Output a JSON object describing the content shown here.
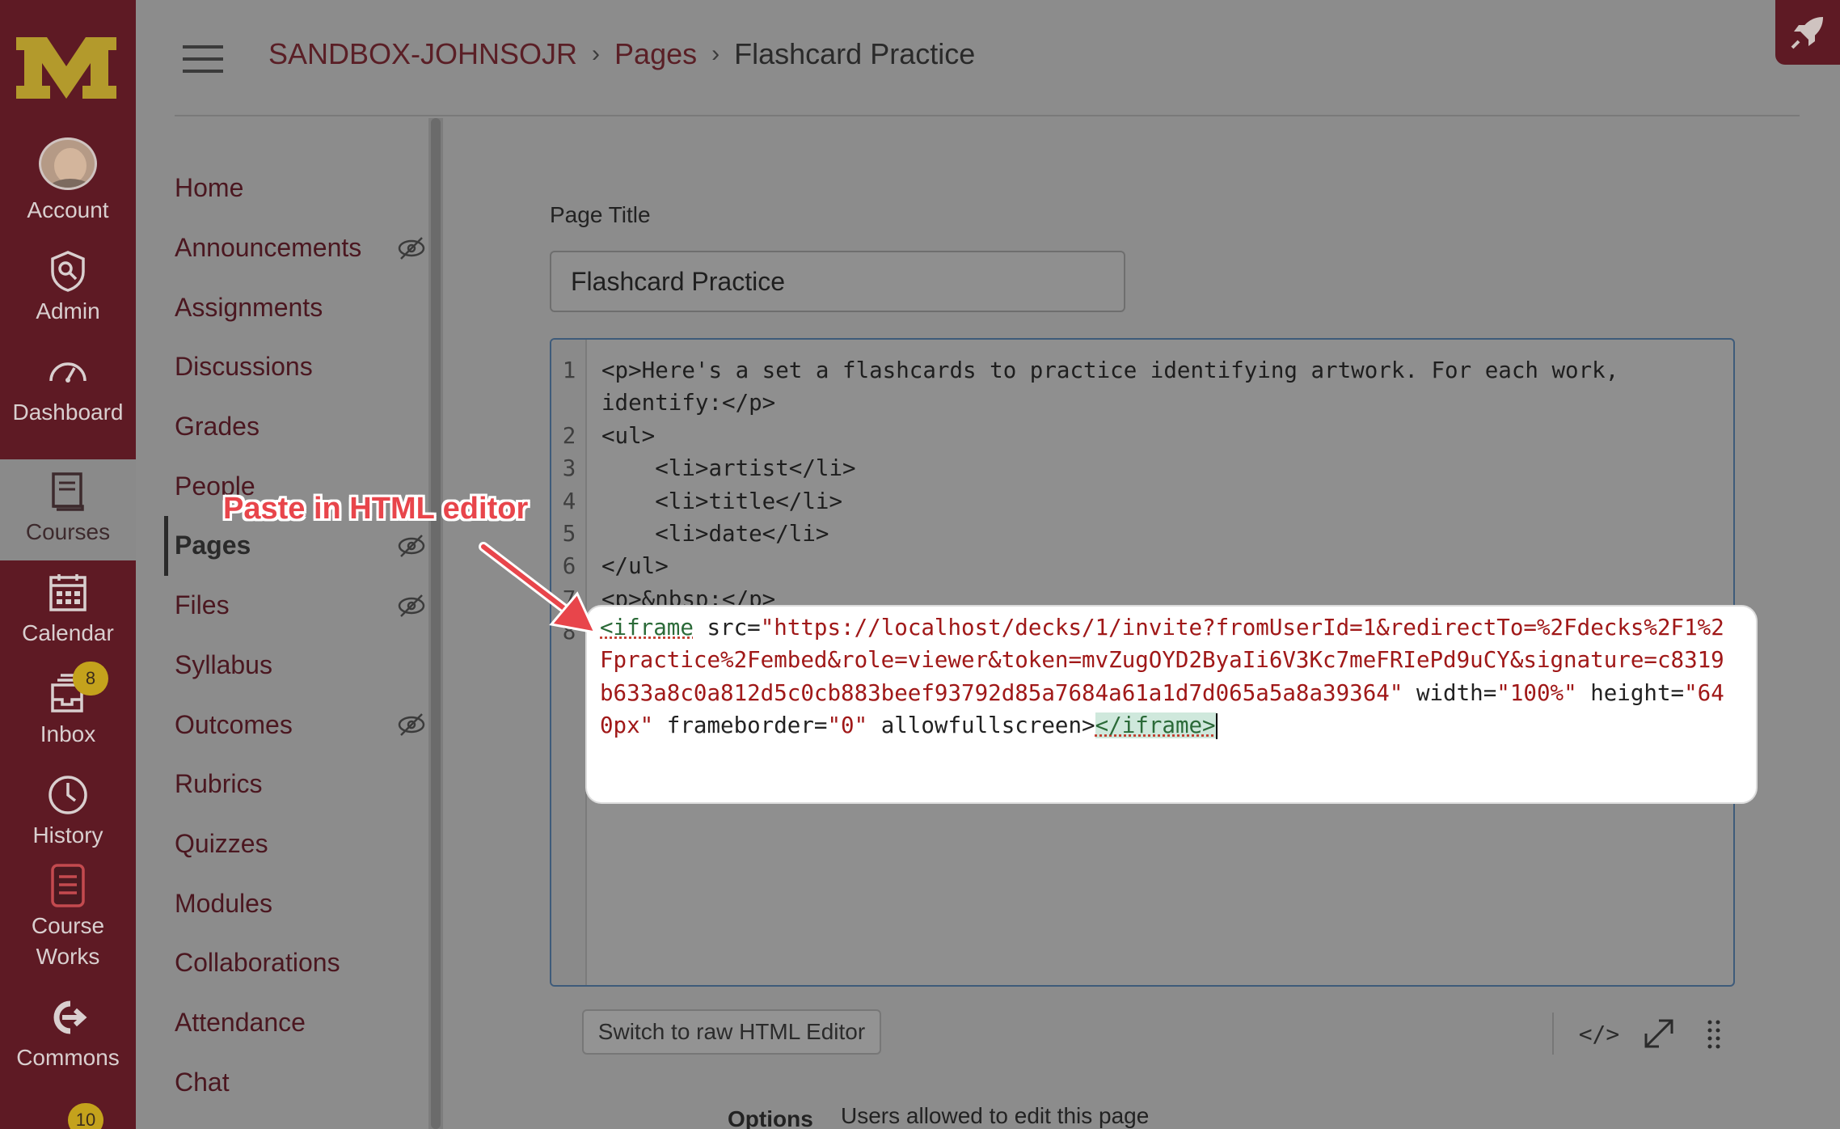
{
  "global_nav": {
    "items": [
      {
        "label": "Account",
        "icon": "avatar"
      },
      {
        "label": "Admin",
        "icon": "admin-icon"
      },
      {
        "label": "Dashboard",
        "icon": "dashboard-icon"
      },
      {
        "label": "Courses",
        "icon": "courses-icon"
      },
      {
        "label": "Calendar",
        "icon": "calendar-icon"
      },
      {
        "label": "Inbox",
        "icon": "inbox-icon",
        "badge": "8"
      },
      {
        "label": "History",
        "icon": "clock-icon"
      },
      {
        "label": "Course\nWorks",
        "icon": "courseworks-icon"
      },
      {
        "label": "Commons",
        "icon": "commons-icon"
      }
    ],
    "bottom_badge": "10"
  },
  "header": {
    "breadcrumbs": [
      "SANDBOX-JOHNSOJR",
      "Pages",
      "Flashcard Practice"
    ]
  },
  "course_nav": {
    "items": [
      {
        "label": "Home",
        "hidden": false
      },
      {
        "label": "Announcements",
        "hidden": true
      },
      {
        "label": "Assignments",
        "hidden": false
      },
      {
        "label": "Discussions",
        "hidden": false
      },
      {
        "label": "Grades",
        "hidden": false
      },
      {
        "label": "People",
        "hidden": false
      },
      {
        "label": "Pages",
        "hidden": true,
        "active": true
      },
      {
        "label": "Files",
        "hidden": true
      },
      {
        "label": "Syllabus",
        "hidden": false
      },
      {
        "label": "Outcomes",
        "hidden": true
      },
      {
        "label": "Rubrics",
        "hidden": false
      },
      {
        "label": "Quizzes",
        "hidden": false
      },
      {
        "label": "Modules",
        "hidden": false
      },
      {
        "label": "Collaborations",
        "hidden": false
      },
      {
        "label": "Attendance",
        "hidden": false
      },
      {
        "label": "Chat",
        "hidden": false
      }
    ]
  },
  "page": {
    "title_label": "Page Title",
    "title_value": "Flashcard Practice"
  },
  "editor": {
    "lines": [
      {
        "n": "1",
        "text": "<p>Here's a set a flashcards to practice identifying artwork. For each work,"
      },
      {
        "n": "",
        "text": "identify:</p>"
      },
      {
        "n": "2",
        "text": "<ul>"
      },
      {
        "n": "3",
        "text": "    <li>artist</li>"
      },
      {
        "n": "4",
        "text": "    <li>title</li>"
      },
      {
        "n": "5",
        "text": "    <li>date</li>"
      },
      {
        "n": "6",
        "text": "</ul>"
      },
      {
        "n": "7",
        "text": "<p>&nbsp;</p>"
      },
      {
        "n": "8",
        "text": ""
      }
    ],
    "iframe_open": "<iframe",
    "iframe_src_attr": " src=",
    "iframe_src": "\"https://localhost/decks/1/invite?fromUserId=1&redirectTo=%2Fdecks%2F1%2Fpractice%2Fembed&role=viewer&token=mvZugOYD2ByaIi6V3Kc7meFRIePd9uCY&signature=c8319b633a8c0a812d5c0cb883beef93792d85a7684a61a1d7d065a5a8a39364\"",
    "iframe_width_attr": " width=",
    "iframe_width": "\"100%\"",
    "iframe_height_attr": " height=",
    "iframe_height": "\"640px\"",
    "iframe_fb_attr": " frameborder=",
    "iframe_fb": "\"0\"",
    "iframe_afs": " allowfullscreen>",
    "iframe_close": "</iframe>",
    "switch_button": "Switch to raw HTML Editor",
    "code_toggle": "</>"
  },
  "annotation": {
    "text": "Paste in HTML editor",
    "color": "#e8454b"
  },
  "footer": {
    "options_label": "Options",
    "users_edit_label": "Users allowed to edit this page"
  },
  "colors": {
    "brand": "#5e1a24",
    "accent": "#c4a21c"
  }
}
